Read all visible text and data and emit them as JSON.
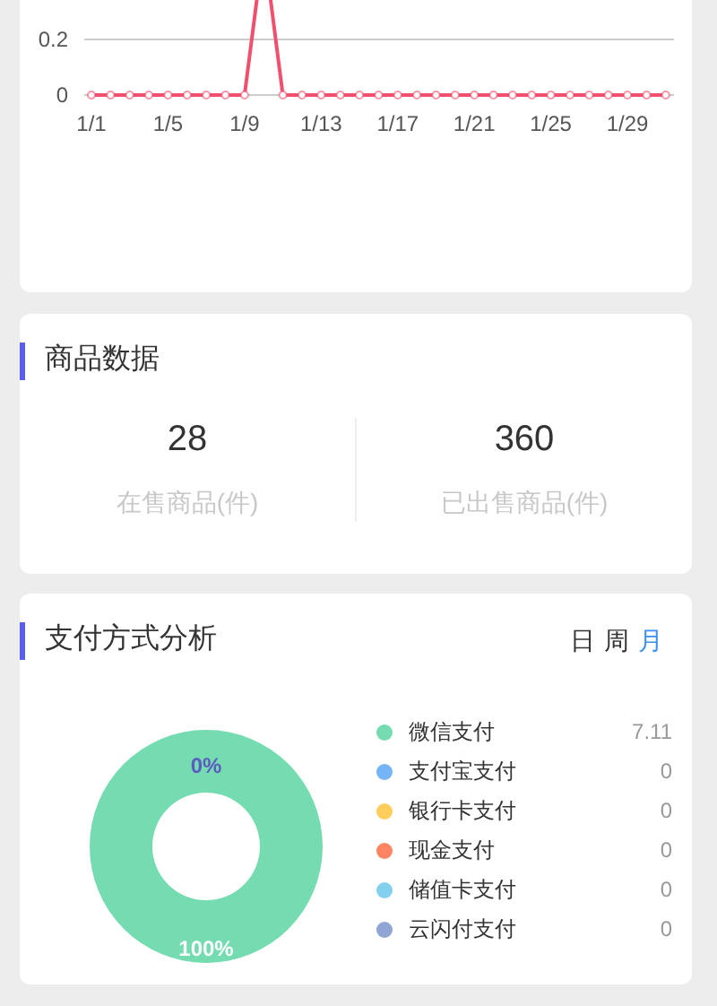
{
  "trend_chart": {
    "chart_data": {
      "type": "line",
      "categories": [
        "1/1",
        null,
        null,
        null,
        "1/5",
        null,
        null,
        null,
        "1/9",
        null,
        null,
        null,
        "1/13",
        null,
        null,
        null,
        "1/17",
        null,
        null,
        null,
        "1/21",
        null,
        null,
        null,
        "1/25",
        null,
        null,
        null,
        "1/29",
        null,
        null
      ],
      "series": [
        {
          "color": "#f0506e",
          "marker": "circle",
          "values": [
            0,
            0,
            0,
            0,
            0,
            0,
            0,
            0,
            0,
            null,
            0,
            0,
            0,
            0,
            0,
            0,
            0,
            0,
            0,
            0,
            0,
            0,
            0,
            0,
            0,
            0,
            0,
            0,
            0,
            0,
            0
          ]
        }
      ],
      "ylim": [
        0,
        0.2
      ],
      "yticks": [
        0,
        0.2
      ]
    }
  },
  "goods": {
    "title": "商品数据",
    "stats": [
      {
        "value": "28",
        "label": "在售商品(件)"
      },
      {
        "value": "360",
        "label": "已出售商品(件)"
      }
    ]
  },
  "payment": {
    "title": "支付方式分析",
    "periods": [
      {
        "label": "日",
        "selected": false
      },
      {
        "label": "周",
        "selected": false
      },
      {
        "label": "月",
        "selected": true
      }
    ],
    "chart_data": {
      "type": "donut",
      "values": [
        100,
        0,
        0,
        0,
        0,
        0
      ]
    },
    "slice_labels": [
      "0%",
      "100%"
    ],
    "legend": [
      {
        "name": "微信支付",
        "value": "7.11",
        "color": "#75dcb2"
      },
      {
        "name": "支付宝支付",
        "value": "0",
        "color": "#74b4f7"
      },
      {
        "name": "银行卡支付",
        "value": "0",
        "color": "#ffcd5b"
      },
      {
        "name": "现金支付",
        "value": "0",
        "color": "#ff8562"
      },
      {
        "name": "储值卡支付",
        "value": "0",
        "color": "#82d0ee"
      },
      {
        "name": "云闪付支付",
        "value": "0",
        "color": "#8fa6d4"
      }
    ]
  }
}
